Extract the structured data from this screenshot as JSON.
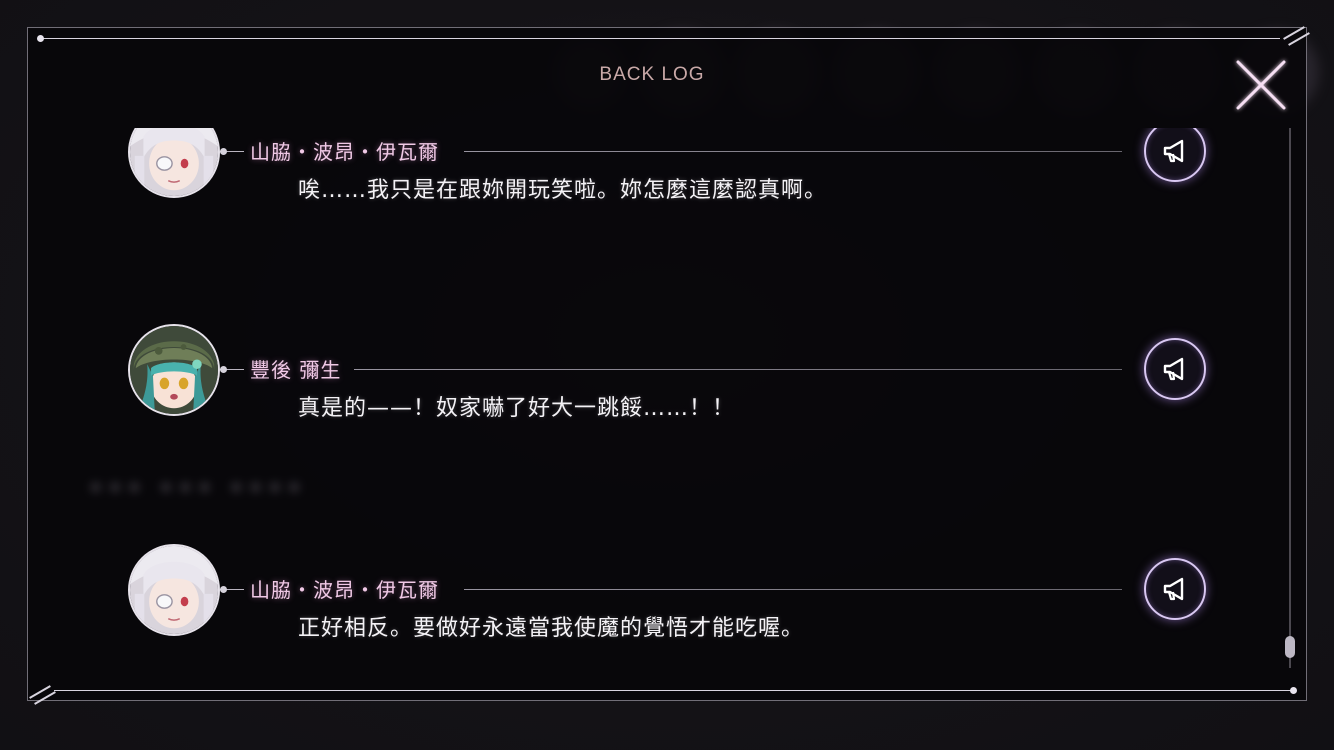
{
  "window": {
    "title": "BACK LOG"
  },
  "background": {
    "blurred_text": "••• ••• ••••"
  },
  "icons": {
    "close": "close-icon",
    "voice": "megaphone-icon"
  },
  "colors": {
    "accent_name": "#f0c9e6",
    "title": "#c9a9a8",
    "voice_glow": "#d9c8f2",
    "close_glow": "#f3c9ee"
  },
  "log": {
    "entries": [
      {
        "speaker": "山脇・波昂・伊瓦爾",
        "text": "唉……我只是在跟妳開玩笑啦。妳怎麼這麼認真啊。",
        "avatar": "silver-hair-eyepatch-girl"
      },
      {
        "speaker": "豐後 彌生",
        "text": "真是的——！奴家嚇了好大一跳餒……！！",
        "avatar": "teal-hair-green-helmet-girl"
      },
      {
        "speaker": "山脇・波昂・伊瓦爾",
        "text": "正好相反。要做好永遠當我使魔的覺悟才能吃喔。",
        "avatar": "silver-hair-eyepatch-girl"
      }
    ]
  }
}
